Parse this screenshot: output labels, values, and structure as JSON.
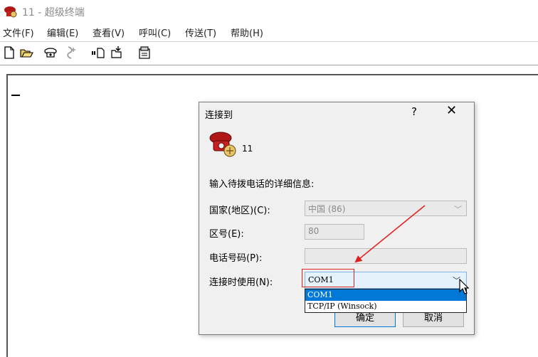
{
  "window": {
    "title": "11 - 超级终端"
  },
  "menu": [
    {
      "label": "文件(F)"
    },
    {
      "label": "编辑(E)"
    },
    {
      "label": "查看(V)"
    },
    {
      "label": "呼叫(C)"
    },
    {
      "label": "传送(T)"
    },
    {
      "label": "帮助(H)"
    }
  ],
  "toolbar": {
    "icons": [
      "new-icon",
      "open-icon",
      "call-icon",
      "disconnect-icon",
      "send-icon",
      "receive-icon",
      "properties-icon"
    ]
  },
  "terminal": {
    "cursor": "_"
  },
  "dialog": {
    "title": "连接到",
    "help": "?",
    "close": "✕",
    "connection_name": "11",
    "prompt": "输入待拨电话的详细信息:",
    "country_label": "国家(地区)(C):",
    "country_value": "中国 (86)",
    "area_label": "区号(E):",
    "area_value": "80",
    "phone_label": "电话号码(P):",
    "phone_value": "",
    "connect_label": "连接时使用(N):",
    "connect_value": "COM1",
    "options": [
      "COM1",
      "TCP/IP (Winsock)"
    ],
    "ok_label": "确定",
    "cancel_label": "取消"
  },
  "colors": {
    "annotation": "#e02020",
    "selection": "#0078d7"
  }
}
